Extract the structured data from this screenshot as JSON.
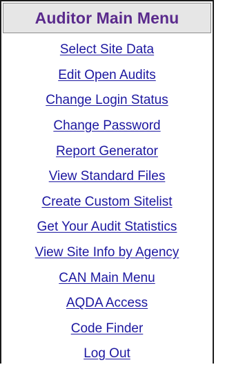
{
  "menu": {
    "title": "Auditor Main Menu",
    "items": [
      {
        "label": "Select Site Data"
      },
      {
        "label": "Edit Open Audits"
      },
      {
        "label": "Change Login Status"
      },
      {
        "label": "Change Password"
      },
      {
        "label": "Report Generator"
      },
      {
        "label": "View Standard Files"
      },
      {
        "label": "Create Custom Sitelist"
      },
      {
        "label": "Get Your Audit Statistics"
      },
      {
        "label": "View Site Info by Agency"
      },
      {
        "label": "CAN Main Menu"
      },
      {
        "label": "AQDA Access"
      },
      {
        "label": "Code Finder"
      },
      {
        "label": "Log Out"
      }
    ]
  },
  "colors": {
    "title": "#5a2a8c",
    "link": "#1c17a0",
    "header_bg": "#e6e6e6",
    "border": "#1a1a1a"
  }
}
